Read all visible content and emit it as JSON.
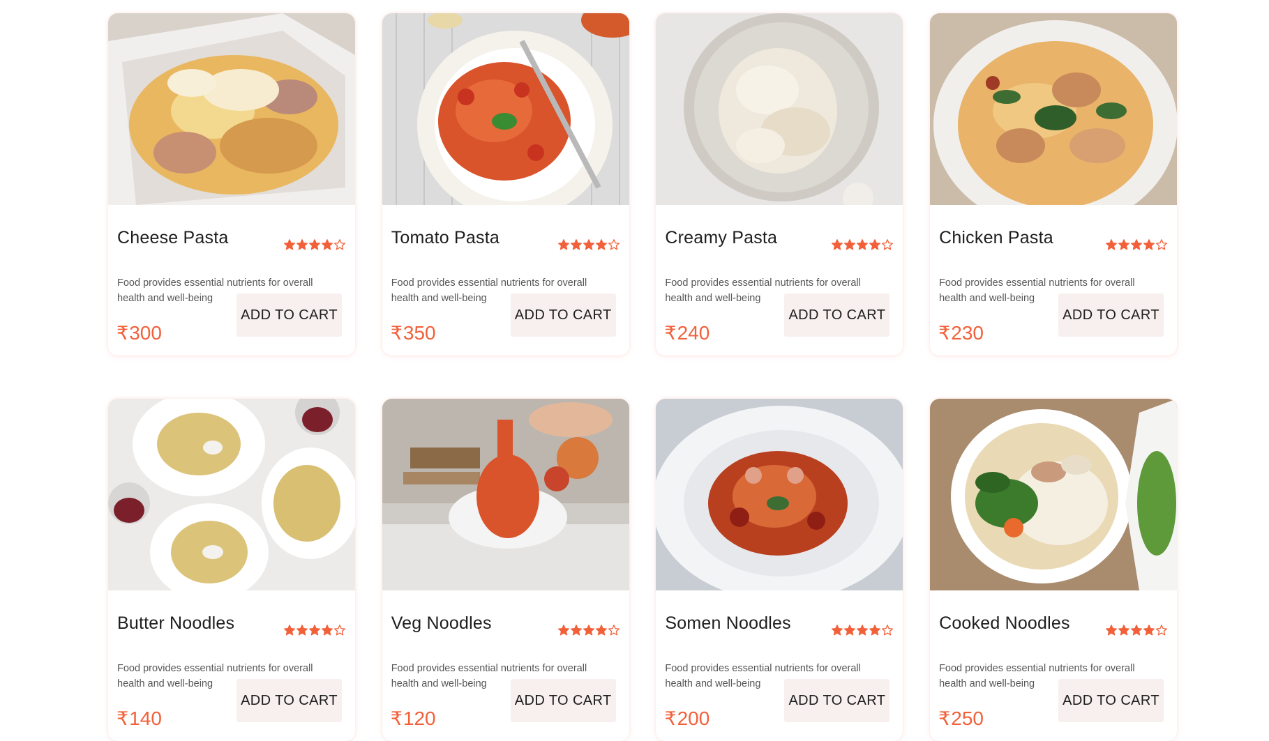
{
  "menu": {
    "star_color": "#f2603a",
    "price_color": "#f2603a",
    "items": [
      {
        "name": "Cheese Pasta",
        "rating": 4,
        "rating_max": 5,
        "description": "Food provides essential nutrients for overall health and well-being",
        "currency": "₹",
        "price": "300",
        "button_label": "ADD TO CART",
        "image": "cheese-pasta-photo"
      },
      {
        "name": "Tomato Pasta",
        "rating": 4,
        "rating_max": 5,
        "description": "Food provides essential nutrients for overall health and well-being",
        "currency": "₹",
        "price": "350",
        "button_label": "ADD TO CART",
        "image": "tomato-pasta-photo"
      },
      {
        "name": "Creamy Pasta",
        "rating": 4,
        "rating_max": 5,
        "description": "Food provides essential nutrients for overall health and well-being",
        "currency": "₹",
        "price": "240",
        "button_label": "ADD TO CART",
        "image": "creamy-pasta-photo"
      },
      {
        "name": "Chicken Pasta",
        "rating": 4,
        "rating_max": 5,
        "description": "Food provides essential nutrients for overall health and well-being",
        "currency": "₹",
        "price": "230",
        "button_label": "ADD TO CART",
        "image": "chicken-pasta-photo"
      },
      {
        "name": "Butter Noodles",
        "rating": 4,
        "rating_max": 5,
        "description": "Food provides essential nutrients for overall health and well-being",
        "currency": "₹",
        "price": "140",
        "button_label": "ADD TO CART",
        "image": "butter-noodles-photo"
      },
      {
        "name": "Veg Noodles",
        "rating": 4,
        "rating_max": 5,
        "description": "Food provides essential nutrients for overall health and well-being",
        "currency": "₹",
        "price": "120",
        "button_label": "ADD TO CART",
        "image": "veg-noodles-photo"
      },
      {
        "name": "Somen Noodles",
        "rating": 4,
        "rating_max": 5,
        "description": "Food provides essential nutrients for overall health and well-being",
        "currency": "₹",
        "price": "200",
        "button_label": "ADD TO CART",
        "image": "somen-noodles-photo"
      },
      {
        "name": "Cooked Noodles",
        "rating": 4,
        "rating_max": 5,
        "description": "Food provides essential nutrients for overall health and well-being",
        "currency": "₹",
        "price": "250",
        "button_label": "ADD TO CART",
        "image": "cooked-noodles-photo"
      }
    ]
  }
}
